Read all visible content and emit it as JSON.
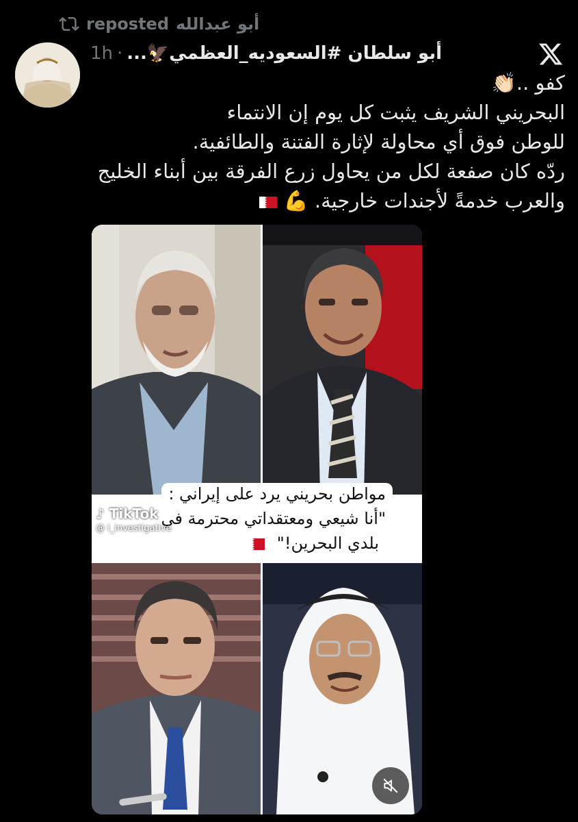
{
  "repost_bar": {
    "icon": "repost-icon",
    "label": "reposted",
    "reposter": "أبو عبدالله"
  },
  "post": {
    "author_display": "أبو سلطان #السعوديه_العظمي🦅...",
    "separator": "·",
    "time": "1h",
    "text_lines": [
      "كفو ..👏🏻",
      "البحريني الشريف يثبت كل يوم إن الانتماء",
      "للوطن فوق أي محاولة لإثارة الفتنة والطائفية.",
      "ردّه كان صفعة لكل من يحاول زرع الفرقة بين أبناء الخليج",
      "والعرب خدمةً لأجندات خارجية. 💪"
    ]
  },
  "video": {
    "caption_lines": [
      "مواطن بحريني يرد على إيراني :",
      "\"أنا شيعي ومعتقداتي محترمة في",
      "بلدي البحرين!\""
    ],
    "watermark_brand": "TikTok",
    "watermark_handle": "@ i_investigative",
    "mute_icon": "speaker-muted-icon"
  },
  "colors": {
    "background": "#000000",
    "text": "#e7e9ea",
    "muted": "#71767b",
    "bahrain_red": "#ce1126"
  }
}
